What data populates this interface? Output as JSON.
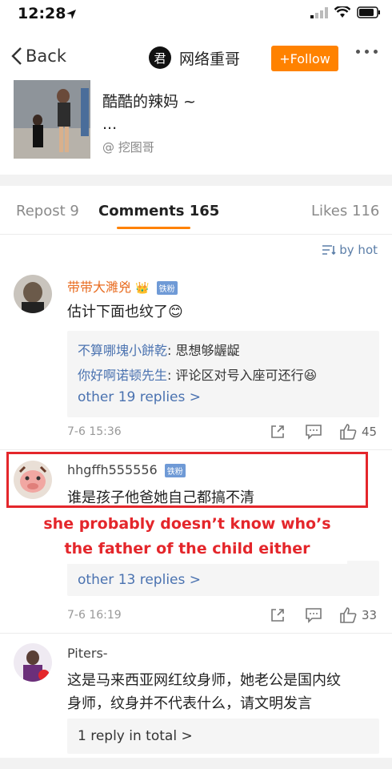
{
  "status": {
    "time": "12:28"
  },
  "nav": {
    "back_label": "Back",
    "logo_char": "君",
    "title": "网络重哥",
    "follow_label": "+Follow"
  },
  "post": {
    "text": "酷酷的辣妈 ~",
    "dots": "...",
    "at": "@ 挖图哥"
  },
  "tabs": [
    {
      "label": "Repost 9"
    },
    {
      "label": "Comments 165"
    },
    {
      "label": "Likes 116"
    }
  ],
  "sort_label": "by hot",
  "comments": [
    {
      "username": "带带大濉兇",
      "badge": "铁粉",
      "text": "估计下面也纹了",
      "replies": [
        {
          "name": "不算哪塊小餅乾",
          "text": ": 思想够龌龊"
        },
        {
          "name": "你好啊诺顿先生",
          "text": ": 评论区对号入座可还行"
        }
      ],
      "other_replies": "other 19 replies >",
      "time": "7-6 15:36",
      "likes": "45"
    },
    {
      "username": "hhgffh555556",
      "badge": "铁粉",
      "text": "谁是孩子他爸她自己都搞不清",
      "other_replies": "other 13 replies >",
      "time": "7-6 16:19",
      "likes": "33"
    },
    {
      "username": "Piters-",
      "text_line1": "这是马来西亚网红纹身师，她老公是国内纹",
      "text_line2": "身师，纹身并不代表什么，请文明发言",
      "reply_total": "1 reply in total >"
    }
  ],
  "overlay": {
    "line1": "she probably doesn’t know who’s",
    "line2": "the father of the child either"
  },
  "colors": {
    "accent": "#ff8200",
    "highlight": "#e4262b",
    "link": "#4a72b0"
  }
}
